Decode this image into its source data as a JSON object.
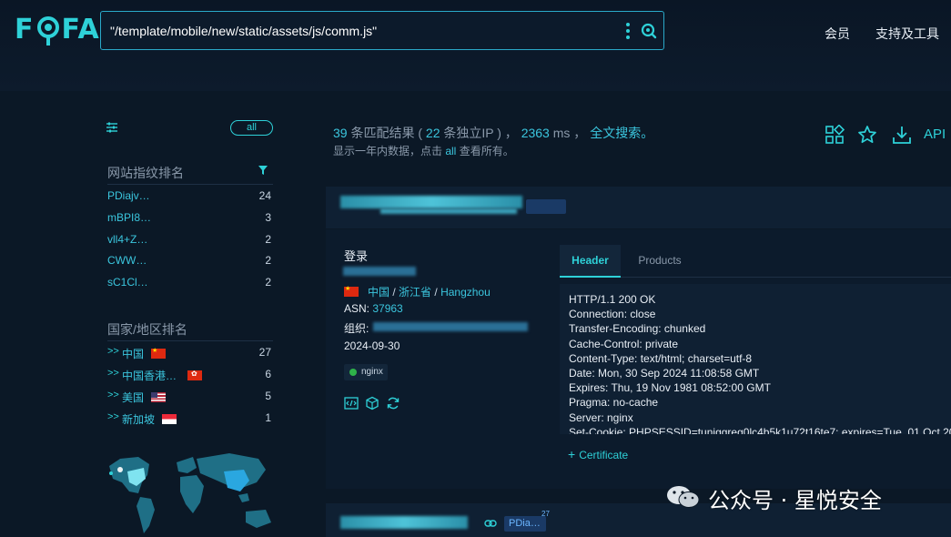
{
  "header": {
    "search_value": "\"/template/mobile/new/static/assets/js/comm.js\"",
    "nav": [
      "会员",
      "支持及工具"
    ]
  },
  "sidebar": {
    "all_label": "all",
    "fingerprint_title": "网站指纹排名",
    "fingerprints": [
      {
        "label": "PDiajv…",
        "count": "24"
      },
      {
        "label": "mBPI8…",
        "count": "3"
      },
      {
        "label": "vll4+Z…",
        "count": "2"
      },
      {
        "label": "CWW…",
        "count": "2"
      },
      {
        "label": "sC1Cl…",
        "count": "2"
      }
    ],
    "country_title": "国家/地区排名",
    "countries": [
      {
        "label": "中国",
        "count": "27",
        "flag": "cn"
      },
      {
        "label": "中国香港…",
        "count": "6",
        "flag": "hk"
      },
      {
        "label": "美国",
        "count": "5",
        "flag": "us"
      },
      {
        "label": "新加坡",
        "count": "1",
        "flag": "sg"
      }
    ]
  },
  "summary": {
    "matches": "39",
    "matches_text": " 条匹配结果 ( ",
    "unique_ip": "22",
    "unique_ip_text": " 条独立IP ) ， ",
    "time": "2363",
    "time_text": " ms ， ",
    "fulltext": "全文搜索。",
    "sub_prefix": "显示一年内数据，点击 ",
    "sub_all": "all",
    "sub_suffix": " 查看所有。",
    "api": "API"
  },
  "result": {
    "title": "登录",
    "country": "中国",
    "province": "浙江省",
    "city": "Hangzhou",
    "sep": " / ",
    "asn_label": "ASN: ",
    "asn": "37963",
    "org_label": "组织: ",
    "date": "2024-09-30",
    "server_tag": "nginx",
    "tabs": [
      "Header",
      "Products"
    ],
    "headers": [
      "HTTP/1.1 200 OK",
      "Connection: close",
      "Transfer-Encoding: chunked",
      "Cache-Control: private",
      "Content-Type: text/html; charset=utf-8",
      "Date: Mon, 30 Sep 2024 11:08:58 GMT",
      "Expires: Thu, 19 Nov 1981 08:52:00 GMT",
      "Pragma: no-cache",
      "Server: nginx",
      "Set-Cookie: PHPSESSID=tunjggreg0lc4b5k1u72t16te7; expires=Tue, 01 Oct 20"
    ],
    "certificate": "Certificate"
  },
  "result2": {
    "tag": "PDia…",
    "tag_count": "27"
  },
  "watermark": "公众号 · 星悦安全",
  "colors": {
    "accent": "#2ed1d8",
    "link": "#3bc6de",
    "background": "#0b1826"
  }
}
